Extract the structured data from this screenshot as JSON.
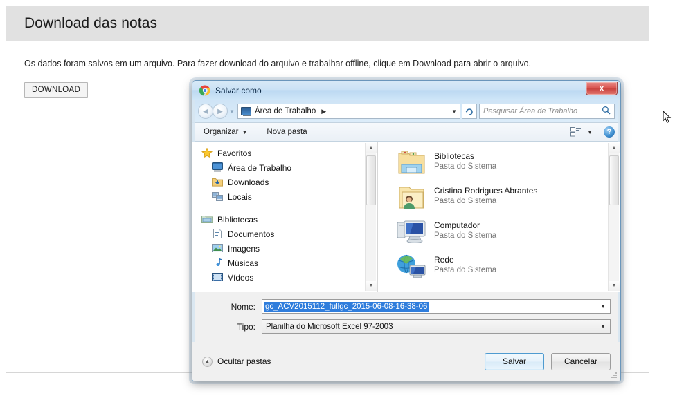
{
  "page": {
    "title": "Download das notas",
    "description": "Os dados foram salvos em um arquivo. Para fazer download do arquivo e trabalhar offline, clique em Download para abrir o arquivo.",
    "download_button": "DOWNLOAD"
  },
  "dialog": {
    "title": "Salvar como",
    "app_icon": "chrome-icon",
    "close_label": "x",
    "nav": {
      "back_icon": "back-arrow-icon",
      "forward_icon": "forward-arrow-icon",
      "history_icon": "chevron-down-icon",
      "address_icon": "desktop-icon",
      "address_text": "Área de Trabalho",
      "address_chevron": "▶",
      "dropdown_icon": "▼",
      "refresh_icon": "↻",
      "search_placeholder": "Pesquisar Área de Trabalho",
      "search_icon": "search-icon"
    },
    "toolbar": {
      "organize": "Organizar",
      "new_folder": "Nova pasta",
      "view_icon": "view-mode-icon",
      "view_caret": "▼",
      "help_icon": "help-icon",
      "help_label": "?"
    },
    "sidebar": {
      "groups": [
        {
          "header": {
            "label": "Favoritos",
            "icon": "star-icon"
          },
          "items": [
            {
              "label": "Área de Trabalho",
              "icon": "desktop-icon"
            },
            {
              "label": "Downloads",
              "icon": "downloads-folder-icon"
            },
            {
              "label": "Locais",
              "icon": "locations-icon"
            }
          ]
        },
        {
          "header": {
            "label": "Bibliotecas",
            "icon": "libraries-icon"
          },
          "items": [
            {
              "label": "Documentos",
              "icon": "documents-icon"
            },
            {
              "label": "Imagens",
              "icon": "pictures-icon"
            },
            {
              "label": "Músicas",
              "icon": "music-icon"
            },
            {
              "label": "Vídeos",
              "icon": "videos-icon"
            }
          ]
        }
      ]
    },
    "files": [
      {
        "name": "Bibliotecas",
        "type": "Pasta do Sistema",
        "icon": "libraries-folder-icon"
      },
      {
        "name": "Cristina Rodrigues Abrantes",
        "type": "Pasta do Sistema",
        "icon": "user-folder-icon"
      },
      {
        "name": "Computador",
        "type": "Pasta do Sistema",
        "icon": "computer-icon"
      },
      {
        "name": "Rede",
        "type": "Pasta do Sistema",
        "icon": "network-icon"
      }
    ],
    "form": {
      "name_label": "Nome:",
      "name_value": "gc_ACV2015112_fullgc_2015-06-08-16-38-06",
      "type_label": "Tipo:",
      "type_value": "Planilha do Microsoft Excel 97-2003",
      "caret": "▼"
    },
    "footer": {
      "hide_folders": "Ocultar pastas",
      "hide_folders_icon": "chevron-up-circle-icon",
      "save": "Salvar",
      "cancel": "Cancelar"
    }
  },
  "colors": {
    "selection_blue": "#2f7ddc",
    "title_bar": "#cbe2f5",
    "close_red": "#d9534f",
    "page_header_gray": "#e1e1e1"
  }
}
